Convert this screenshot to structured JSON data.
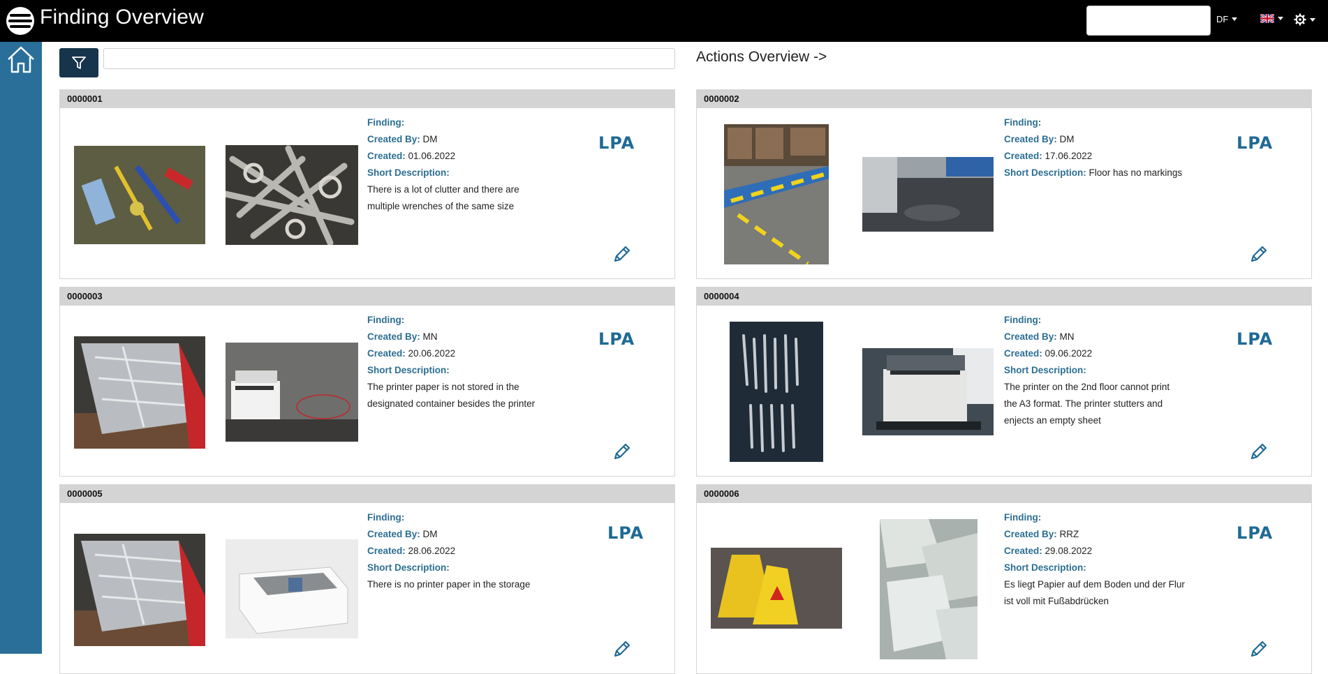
{
  "app": {
    "title": "Finding Overview"
  },
  "header": {
    "search_value": "",
    "lang_code": "DF",
    "flag_icon": "uk-flag-icon",
    "settings_icon": "gear-icon"
  },
  "toolbar": {
    "filter_value": "",
    "actions_link": "Actions Overview ->"
  },
  "labels": {
    "finding": "Finding:",
    "created_by": "Created By:",
    "created": "Created:",
    "short_description": "Short Description:"
  },
  "cards": [
    {
      "id": "0000001",
      "created_by": "DM",
      "created": "01.06.2022",
      "description_line1": "There is a lot of clutter and there are",
      "description_line2": "multiple wrenches of the same size",
      "badge": "LPA"
    },
    {
      "id": "0000002",
      "created_by": "DM",
      "created": "17.06.2022",
      "description_inline": "Floor has no markings",
      "badge": "LPA"
    },
    {
      "id": "0000003",
      "created_by": "MN",
      "created": "20.06.2022",
      "description_line1": "The printer paper is not stored in the",
      "description_line2": "designated container besides the printer",
      "badge": "LPA"
    },
    {
      "id": "0000004",
      "created_by": "MN",
      "created": "09.06.2022",
      "description_line1": "The printer on the 2nd floor cannot print",
      "description_line2": "the A3 format. The printer stutters and",
      "description_line3": "enjects an empty sheet",
      "badge": "LPA"
    },
    {
      "id": "0000005",
      "created_by": "DM",
      "created": "28.06.2022",
      "description_line1": "There is no printer paper in the storage",
      "badge": "LPA"
    },
    {
      "id": "0000006",
      "created_by": "RRZ",
      "created": "29.08.2022",
      "description_line1": "Es liegt Papier auf dem Boden und der Flur",
      "description_line2": "ist voll mit Fußabdrücken",
      "badge": "LPA"
    }
  ],
  "colors": {
    "sidebar": "#2a6f9a",
    "label": "#2c6e93",
    "filter_button": "#16344c"
  }
}
